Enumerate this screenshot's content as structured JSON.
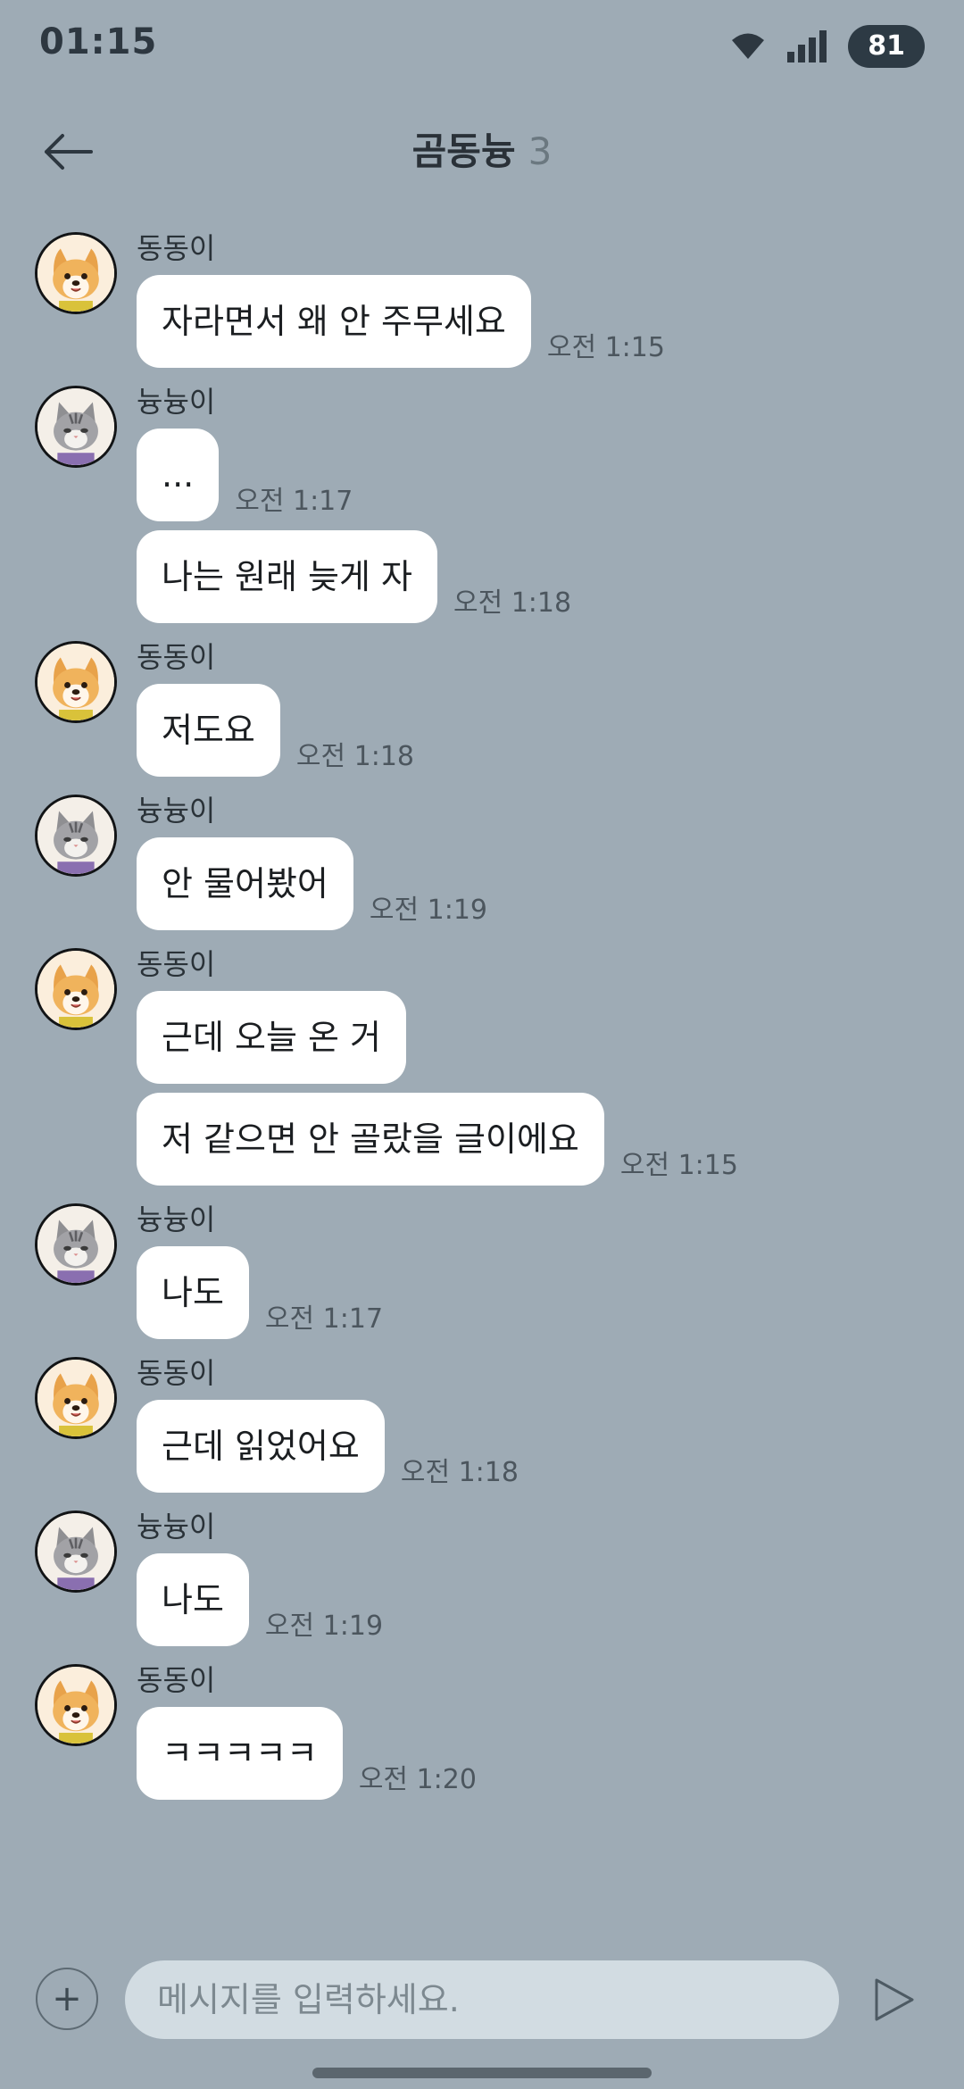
{
  "theme": {
    "background": "#9eabb5",
    "bubble": "#ffffff",
    "input_bg": "#d2dce2"
  },
  "status_bar": {
    "time": "01:15",
    "battery": "81",
    "icons": [
      "wifi-icon",
      "signal-icon"
    ]
  },
  "header": {
    "title": "곰동늉",
    "member_count": "3",
    "back_icon": "arrow-left-icon"
  },
  "messages": [
    {
      "sender": "동동이",
      "avatar": "dog",
      "items": [
        {
          "text": "자라면서 왜 안 주무세요",
          "time": "오전 1:15"
        }
      ]
    },
    {
      "sender": "늉늉이",
      "avatar": "cat",
      "items": [
        {
          "text": "...",
          "time": "오전 1:17"
        },
        {
          "text": "나는 원래 늦게 자",
          "time": "오전 1:18"
        }
      ]
    },
    {
      "sender": "동동이",
      "avatar": "dog",
      "items": [
        {
          "text": "저도요",
          "time": "오전 1:18"
        }
      ]
    },
    {
      "sender": "늉늉이",
      "avatar": "cat",
      "items": [
        {
          "text": "안 물어봤어",
          "time": "오전 1:19"
        }
      ]
    },
    {
      "sender": "동동이",
      "avatar": "dog",
      "items": [
        {
          "text": "근데 오늘 온 거",
          "time": ""
        },
        {
          "text": "저 같으면 안 골랐을 글이에요",
          "time": "오전 1:15"
        }
      ]
    },
    {
      "sender": "늉늉이",
      "avatar": "cat",
      "items": [
        {
          "text": "나도",
          "time": "오전 1:17"
        }
      ]
    },
    {
      "sender": "동동이",
      "avatar": "dog",
      "items": [
        {
          "text": "근데 읽었어요",
          "time": "오전 1:18"
        }
      ]
    },
    {
      "sender": "늉늉이",
      "avatar": "cat",
      "items": [
        {
          "text": "나도",
          "time": "오전 1:19"
        }
      ]
    },
    {
      "sender": "동동이",
      "avatar": "dog",
      "items": [
        {
          "text": "ㅋㅋㅋㅋㅋ",
          "time": "오전 1:20"
        }
      ]
    }
  ],
  "input": {
    "placeholder": "메시지를 입력하세요.",
    "value": "",
    "plus_icon": "plus-icon",
    "send_icon": "send-icon"
  }
}
